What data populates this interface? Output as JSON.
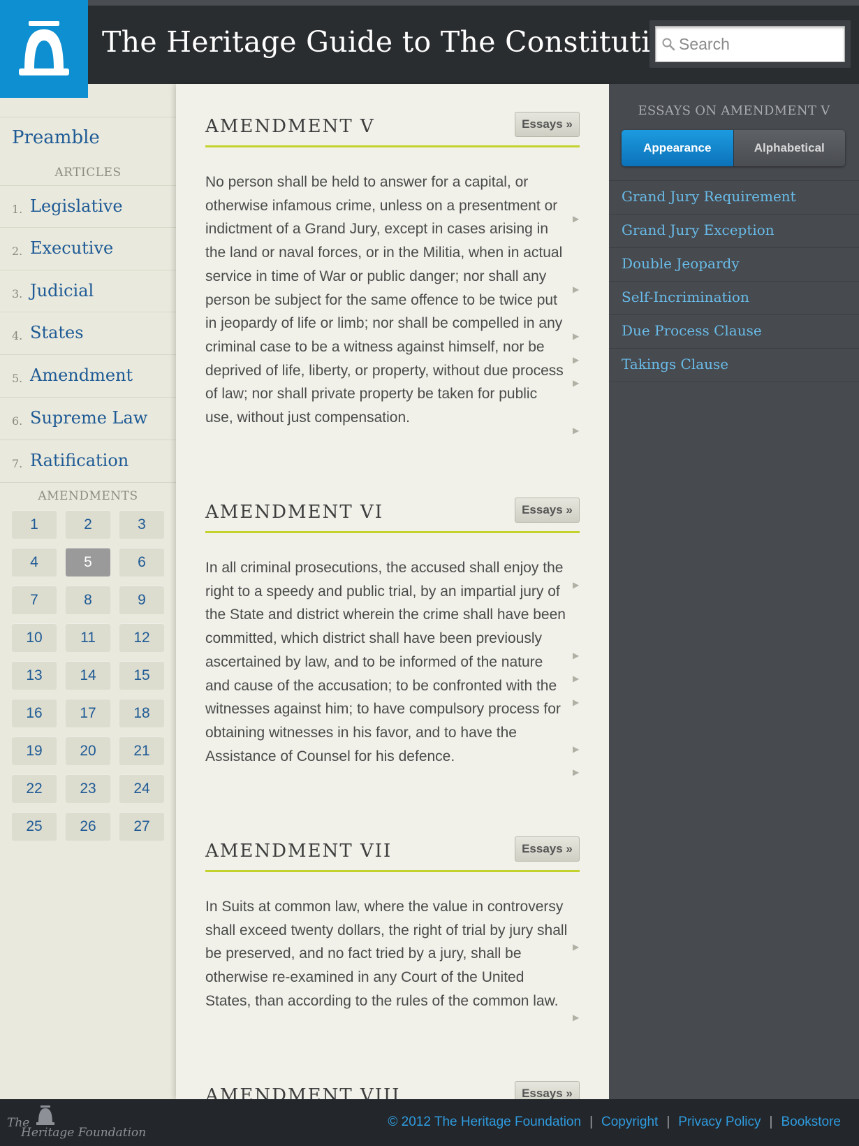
{
  "header": {
    "title": "The Heritage Guide to The Constitution",
    "search_placeholder": "Search"
  },
  "left_nav": {
    "preamble": "Preamble",
    "articles_heading": "ARTICLES",
    "articles": [
      {
        "num": "1.",
        "label": "Legislative"
      },
      {
        "num": "2.",
        "label": "Executive"
      },
      {
        "num": "3.",
        "label": "Judicial"
      },
      {
        "num": "4.",
        "label": "States"
      },
      {
        "num": "5.",
        "label": "Amendment"
      },
      {
        "num": "6.",
        "label": "Supreme Law"
      },
      {
        "num": "7.",
        "label": "Ratification"
      }
    ],
    "amendments_heading": "AMENDMENTS",
    "amendments": [
      "1",
      "2",
      "3",
      "4",
      "5",
      "6",
      "7",
      "8",
      "9",
      "10",
      "11",
      "12",
      "13",
      "14",
      "15",
      "16",
      "17",
      "18",
      "19",
      "20",
      "21",
      "22",
      "23",
      "24",
      "25",
      "26",
      "27"
    ],
    "active_amendment": "5"
  },
  "main": {
    "essays_label": "Essays »",
    "sections": [
      {
        "title": "AMENDMENT V",
        "text": "No person shall be held to answer for a capital, or otherwise infamous crime, unless on a presentment or indictment of a Grand Jury, except in cases arising in the land or naval forces, or in the Militia, when in actual service in time of War or public danger; nor shall any person be subject for the same offence to be twice put in jeopardy of life or limb; nor shall be compelled in any criminal case to be a witness against himself, nor be deprived of life, liberty, or property, without due process of law; nor shall private property be taken for public use, without just compensation."
      },
      {
        "title": "AMENDMENT VI",
        "text": "In all criminal prosecutions, the accused shall enjoy the right to a speedy and public trial, by an impartial jury of the State and district wherein the crime shall have been committed, which district shall have been previously ascertained by law, and to be informed of the nature and cause of the accusation; to be confronted with the witnesses against him; to have compulsory process for obtaining witnesses in his favor, and to have the Assistance of Counsel for his defence."
      },
      {
        "title": "AMENDMENT VII",
        "text": "In Suits at common law, where the value in controversy shall exceed twenty dollars, the right of trial by jury shall be preserved, and no fact tried by a jury, shall be otherwise re-examined in any Court of the United States, than according to the rules of the common law."
      },
      {
        "title": "AMENDMENT VIII",
        "text": ""
      }
    ]
  },
  "right_panel": {
    "heading": "ESSAYS ON AMENDMENT V",
    "tab_appearance": "Appearance",
    "tab_alphabetical": "Alphabetical",
    "active_tab": "Appearance",
    "essays": [
      "Grand Jury Requirement",
      "Grand Jury Exception",
      "Double Jeopardy",
      "Self-Incrimination",
      "Due Process Clause",
      "Takings Clause"
    ]
  },
  "footer": {
    "logo_line1": "The",
    "logo_line2": "Heritage Foundation",
    "copyright": "© 2012 The Heritage Foundation",
    "links": [
      "Copyright",
      "Privacy Policy",
      "Bookstore"
    ],
    "separator": "|"
  },
  "colors": {
    "brand_blue": "#0d8fd1",
    "link_blue": "#1e5a95",
    "accent_rule": "#c4d22d",
    "essay_link": "#69bce9",
    "header_bg": "#2a2d30"
  }
}
